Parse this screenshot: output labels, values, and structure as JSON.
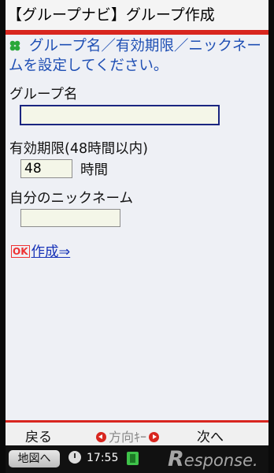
{
  "header": {
    "title": "【グループナビ】グループ作成"
  },
  "instruction": {
    "text": "グループ名／有効期限／ニックネームを設定してください。"
  },
  "form": {
    "group_name": {
      "label": "グループ名",
      "value": ""
    },
    "expiry": {
      "label": "有効期限(48時間以内)",
      "value": "48",
      "unit": "時間"
    },
    "nickname": {
      "label": "自分のニックネーム",
      "value": ""
    },
    "submit": {
      "badge": "OK",
      "label": "作成⇒"
    }
  },
  "softkeys": {
    "left": "戻る",
    "center": "方向ｷｰ",
    "right": "次へ"
  },
  "status": {
    "map_button": "地図へ",
    "time": "17:55"
  },
  "watermark": {
    "text": "esponse.",
    "initial": "R"
  },
  "colors": {
    "accent_red": "#d8261f",
    "link_blue": "#1733b8",
    "instruction_blue": "#1f4fb4",
    "field_border": "#1a2580"
  },
  "icons": {
    "instruction": "clover-icon",
    "status_clock": "clock-icon",
    "status_battery": "battery-icon"
  }
}
